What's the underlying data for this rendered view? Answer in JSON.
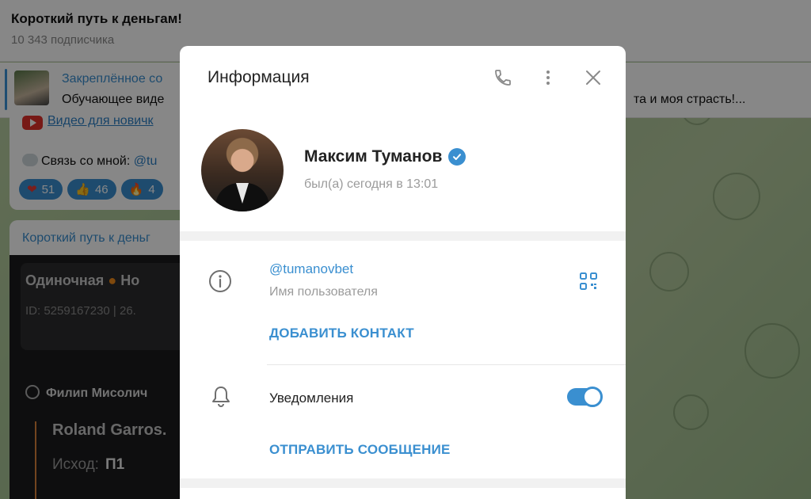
{
  "chat": {
    "title": "Короткий путь к деньгам!",
    "subscribers": "10 343 подписчика"
  },
  "pinned": {
    "title": "Закреплённое со",
    "text": "Обучающее виде",
    "text_tail": "та и моя страсть!..."
  },
  "message1": {
    "video_link": "Видео для новичк",
    "contact_prefix": "Связь со мной: ",
    "contact_link": "@tu",
    "reactions": [
      {
        "emoji": "❤",
        "count": "51"
      },
      {
        "emoji": "👍",
        "count": "46"
      },
      {
        "emoji": "🔥",
        "count": "4"
      }
    ]
  },
  "message2": {
    "author": "Короткий путь к деньг",
    "bet_type": "Одиночная",
    "bet_type_tail": "Но",
    "bet_id": "ID: 5259167230  |  26.",
    "match": "Филип Мисолич",
    "tournament": "Roland Garros.",
    "outcome_label": "Исход:",
    "outcome_value": "П1"
  },
  "modal": {
    "title": "Информация",
    "name": "Максим Туманов",
    "status": "был(а) сегодня в 13:01",
    "username": "@tumanovbet",
    "username_label": "Имя пользователя",
    "add_contact": "ДОБАВИТЬ КОНТАКТ",
    "notifications_label": "Уведомления",
    "notifications_on": true,
    "send_message": "ОТПРАВИТЬ СООБЩЕНИЕ"
  },
  "colors": {
    "accent": "#3a8fd0",
    "verified": "#3a8fd0",
    "bet_dot": "#f08a1a"
  },
  "icons": [
    "phone-icon",
    "more-vert-icon",
    "close-icon",
    "verified-icon",
    "info-icon",
    "qr-code-icon",
    "bell-icon",
    "youtube-icon",
    "tennis-ball-icon"
  ]
}
